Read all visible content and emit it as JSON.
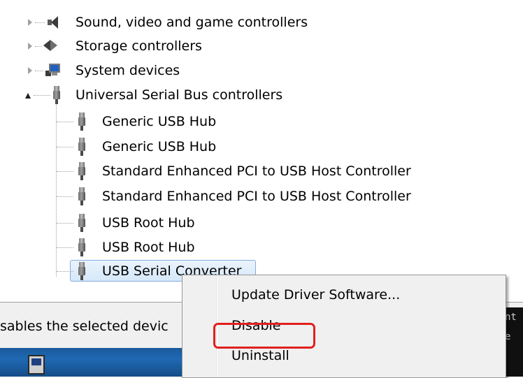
{
  "tree": {
    "categories": [
      {
        "label": "Sound, video and game controllers",
        "icon": "speaker-icon",
        "state": "collapsed"
      },
      {
        "label": "Storage controllers",
        "icon": "storage-controller-icon",
        "state": "collapsed"
      },
      {
        "label": "System devices",
        "icon": "system-device-icon",
        "state": "collapsed"
      },
      {
        "label": "Universal Serial Bus controllers",
        "icon": "usb-icon",
        "state": "expanded"
      }
    ],
    "usb_children": [
      {
        "label": "Generic USB Hub"
      },
      {
        "label": "Generic USB Hub"
      },
      {
        "label": "Standard Enhanced PCI to USB Host Controller"
      },
      {
        "label": "Standard Enhanced PCI to USB Host Controller"
      },
      {
        "label": "USB Root Hub"
      },
      {
        "label": "USB Root Hub"
      },
      {
        "label": "USB Serial Converter",
        "selected": true
      }
    ]
  },
  "status_bar": {
    "text": "sables the selected devic"
  },
  "context_menu": {
    "items": [
      {
        "label": "Update Driver Software..."
      },
      {
        "label": "Disable"
      },
      {
        "label": "Uninstall",
        "highlighted": true
      }
    ]
  },
  "console": {
    "lines": [
      "nt",
      "e"
    ]
  },
  "colors": {
    "selection_fill": "#dbeaf9",
    "selection_border": "#84acdd",
    "highlight_annotation": "#e0201e",
    "menu_background": "#f0f0f0",
    "desktop_blue": "#1f69b3"
  }
}
